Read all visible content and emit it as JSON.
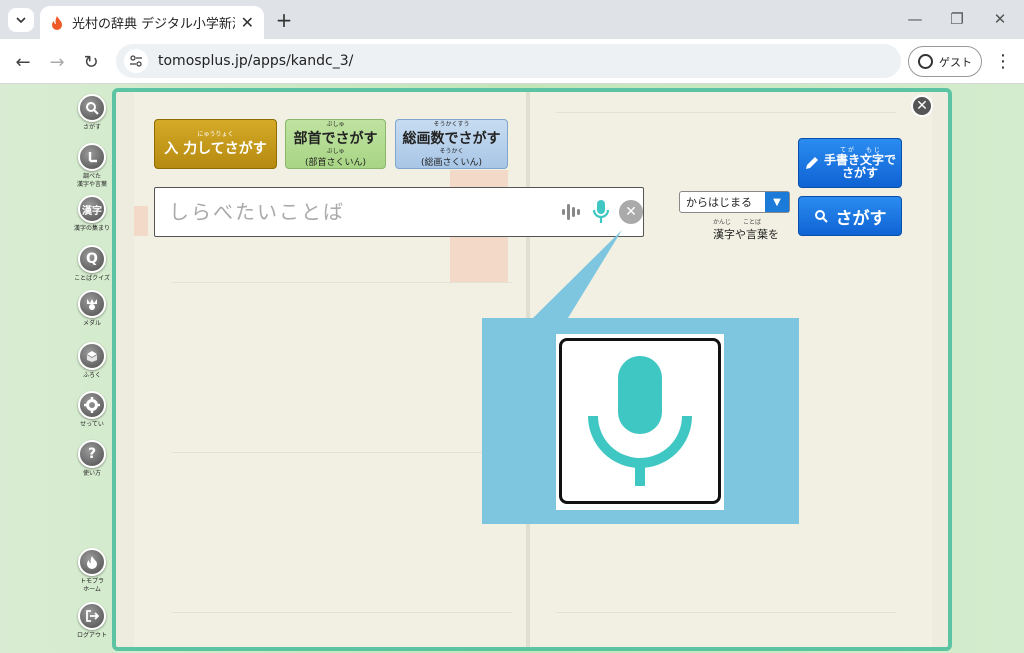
{
  "browser": {
    "tab_title": "光村の辞典 デジタル小学新漢字辞典",
    "url": "tomosplus.jp/apps/kandc_3/",
    "profile_label": "ゲスト"
  },
  "sidebar": {
    "items": [
      {
        "label": "さがす",
        "icon": "magnifier-icon"
      },
      {
        "label": "調べた\n漢字や言葉",
        "icon": "clock-icon"
      },
      {
        "label": "漢字の集まり",
        "icon": "kanji-icon",
        "glyph": "漢字"
      },
      {
        "label": "ことばクイズ",
        "icon": "quiz-icon",
        "glyph": "Q"
      },
      {
        "label": "メダル",
        "icon": "medal-icon"
      },
      {
        "label": "ふろく",
        "icon": "gift-icon"
      },
      {
        "label": "せってい",
        "icon": "gear-icon"
      },
      {
        "label": "使い方",
        "icon": "help-icon",
        "glyph": "?"
      },
      {
        "label": "トモプラ\nホーム",
        "icon": "home-icon"
      },
      {
        "label": "ログアウト",
        "icon": "logout-icon"
      }
    ]
  },
  "search_panel": {
    "input_mode_ruby": "にゅうりょく",
    "input_mode_label": "入 力してさがす",
    "bushu_ruby": "ぶしゅ",
    "bushu_label": "部首でさがす",
    "bushu_sub": "(部首さくいん)",
    "bushu_sub_ruby": "ぶしゅ",
    "sokaku_ruby": "そうかくすう",
    "sokaku_label": "総画数でさがす",
    "sokaku_sub": "(総画さくいん)",
    "sokaku_sub_ruby": "そうかく",
    "placeholder": "しらべたいことば",
    "match_mode": "からはじまる",
    "kanji_note_ruby": "かんじ　　ことば",
    "kanji_note": "漢字や言葉を",
    "handwriting_ruby": "て が　　も じ",
    "handwriting_label": "手書き文字で\nさがす",
    "search_button": "さがす"
  },
  "colors": {
    "frame": "#5cc4a3",
    "mic": "#3fc7c3",
    "callout": "#7ec6e0",
    "primary_button": "#1c73e0",
    "input_button": "#c99a1c"
  }
}
